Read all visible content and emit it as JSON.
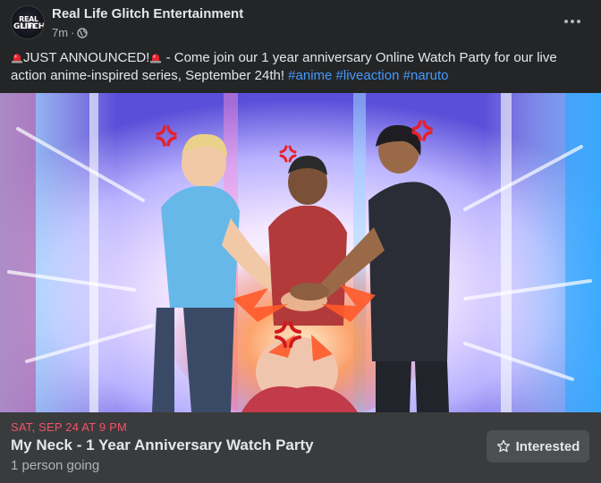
{
  "post": {
    "page_name": "Real Life Glitch Entertainment",
    "avatar_logo_line1": "REAL LIFE",
    "avatar_logo_line2": "GLITCH",
    "time": "7m",
    "separator": "·",
    "audience_icon": "globe-icon",
    "more_icon": "more-options-icon",
    "text_prefix": "JUST ANNOUNCED!",
    "text_body": " - Come join our 1 year anniversary Online Watch Party for our live action anime-inspired series, September 24th! ",
    "hashtags": [
      "#anime",
      "#liveaction",
      "#naruto"
    ],
    "emoji_icon": "police-light-icon"
  },
  "media": {
    "description_icon": "anger-symbol-icon"
  },
  "event": {
    "date": "SAT, SEP 24 AT 9 PM",
    "title": "My Neck - 1 Year Anniversary Watch Party",
    "going": "1 person going",
    "interested_label": "Interested",
    "interested_icon": "star-icon"
  },
  "colors": {
    "background": "#242526",
    "event_bar": "#3a3b3c",
    "date_red": "#f25268",
    "hashtag_blue": "#4599ff"
  }
}
